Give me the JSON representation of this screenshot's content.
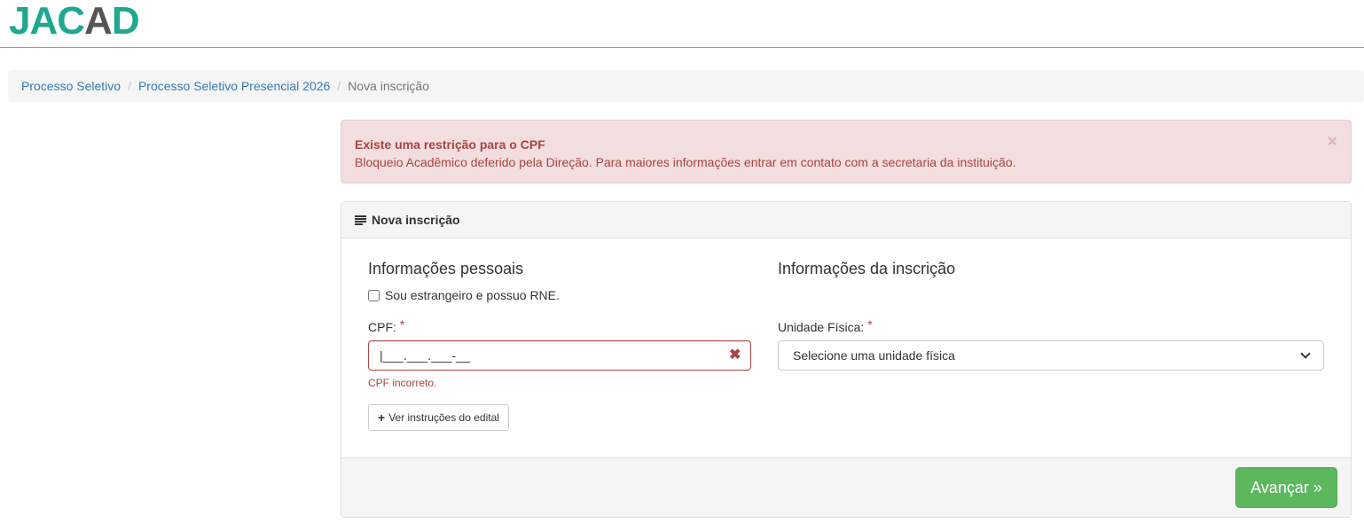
{
  "header": {
    "logo_prefix": "JAC",
    "logo_accent": "A",
    "logo_suffix": "D"
  },
  "breadcrumb": {
    "items": [
      "Processo Seletivo",
      "Processo Seletivo Presencial 2026"
    ],
    "separator": "/",
    "active": "Nova inscrição"
  },
  "alert": {
    "title": "Existe uma restrição para o CPF",
    "message": "Bloqueio Acadêmico deferido pela Direção. Para maiores informações entrar em contato com a secretaria da instituição.",
    "close": "×"
  },
  "panel": {
    "title": "Nova inscrição",
    "personal": {
      "title": "Informações pessoais",
      "foreigner_label": "Sou estrangeiro e possuo RNE.",
      "cpf_label": "CPF:",
      "required_mark": "*",
      "cpf_value": "|___.___.___-__",
      "cpf_clear": "✖",
      "cpf_error": "CPF incorreto.",
      "edital_button": "Ver instruções do edital",
      "edital_plus": "+"
    },
    "registration": {
      "title": "Informações da inscrição",
      "unit_label": "Unidade Física:",
      "required_mark": "*",
      "unit_selected": "Selecione uma unidade física"
    },
    "footer": {
      "next_button": "Avançar",
      "next_icon": "»"
    }
  },
  "colors": {
    "brand": "#1ea88f",
    "link": "#337ab7",
    "danger": "#a94442",
    "success": "#5cb85c"
  }
}
